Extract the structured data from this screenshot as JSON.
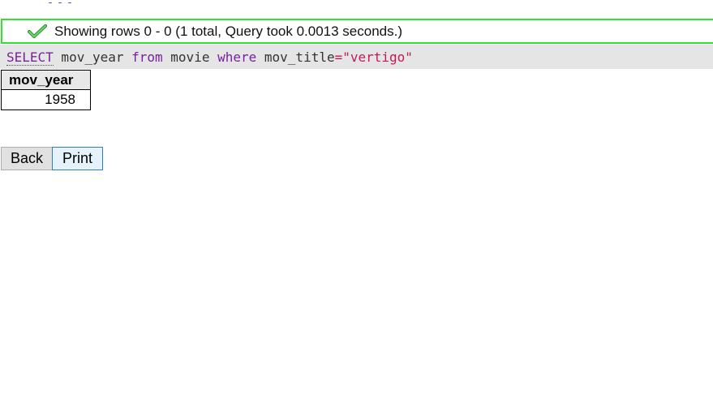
{
  "status": {
    "icon": "checkmark-icon",
    "message": "Showing rows 0 - 0 (1 total, Query took 0.0013 seconds.)",
    "color": "#33e033"
  },
  "sql": {
    "select": "SELECT",
    "column": " mov_year ",
    "from": "from",
    "table": " movie ",
    "where": "where",
    "field": " mov_title",
    "operator": "=",
    "value": "\"vertigo\""
  },
  "results": {
    "columns": [
      "mov_year"
    ],
    "rows": [
      [
        "1958"
      ]
    ]
  },
  "buttons": {
    "back_label": "Back",
    "print_label": "Print"
  }
}
